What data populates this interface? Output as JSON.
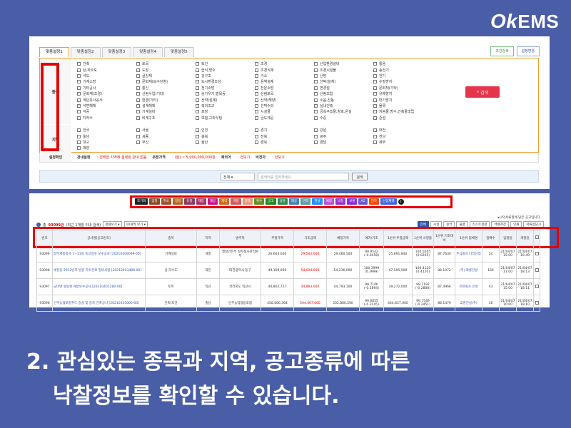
{
  "brand": {
    "logo_ok": "Ok",
    "logo_ems": "EMS"
  },
  "panel1": {
    "tabs": [
      "맞춤설정1",
      "맞춤설정2",
      "맞춤설정3",
      "맞춤설정4",
      "맞춤설정5"
    ],
    "right_buttons": [
      "조건검색",
      "설정변경"
    ],
    "category_label": "종목",
    "category_items": [
      "건축",
      "토목",
      "토건",
      "조경",
      "산업환경설비",
      "통용",
      "상,하수도",
      "도장",
      "습식,방수",
      "조경식재",
      "조경시설물",
      "송전기",
      "석도",
      "골강재",
      "강구조",
      "가스",
      "난방",
      "전기",
      "기계소방",
      "문화재(보수단청)",
      "도시환경조성",
      "용역설계",
      "선박(설계)",
      "수질방지",
      "기타공사",
      "통신",
      "전기소방",
      "전문소방",
      "변경설",
      "문화재(기타)",
      "문화재(조경)",
      "산림사업(기타)",
      "승가우기,벌목등",
      "산림토목",
      "산림조합",
      "유해방지",
      "계단유사공사",
      "환경(기타)",
      "산약(설계)",
      "산약(해양)",
      "소음,진동",
      "대기방지",
      "석면해체",
      "설계해체",
      "축의조고",
      "선박수리",
      "실내건축",
      "물류",
      "석공",
      "기계설비",
      "포장",
      "시설물",
      "금속구조물,창호,온실",
      "지붕물 방수,건축물조립",
      "지하수",
      "비계구조",
      "보험,그라우팅",
      "금도체공",
      "수중",
      "준설"
    ],
    "region_label": "지역",
    "region_items": [
      "전국",
      "서울",
      "인천",
      "경기",
      "강원",
      "대전",
      "충남",
      "세종",
      "충북",
      "전북",
      "광주",
      "전남",
      "대구",
      "부산",
      "울산",
      "경북",
      "경남",
      "제주",
      "제양"
    ],
    "search_button": "검색",
    "settings": {
      "label": "설정확인",
      "filter_title": "관내설정",
      "filter_value": ": 선택한 지역에 설정된 관내 없음",
      "price_title": "추정가격",
      "price_value": ": (원) ~ 5,000,000,000원",
      "exclude_title": "제외어",
      "exclude_value": ": 전보기",
      "exclude2_title": "비전자",
      "exclude2_value": ": 전보기"
    },
    "search_bar": {
      "select": "전체",
      "placeholder": "검색어를 입력하세요.",
      "button": "검색"
    }
  },
  "panel2": {
    "chips": [
      {
        "label": "조기화",
        "color": "#222222"
      },
      {
        "label": "입찰",
        "color": "#8a4b2a"
      },
      {
        "label": "취소",
        "color": "#a0522d"
      },
      {
        "label": "정정",
        "color": "#b5651d"
      },
      {
        "label": "유찰",
        "color": "#8b3a62"
      },
      {
        "label": "재입",
        "color": "#b03060"
      },
      {
        "label": "재공",
        "color": "#c71585"
      },
      {
        "label": "계약",
        "color": "#d2691e"
      },
      {
        "label": "개찰",
        "color": "#cd5c5c"
      },
      {
        "label": "결과",
        "color": "#e9967a"
      },
      {
        "label": "복수",
        "color": "#6b8e23"
      },
      {
        "label": "공고",
        "color": "#228b22"
      },
      {
        "label": "설명",
        "color": "#2e8b57"
      },
      {
        "label": "재공",
        "color": "#4682b4"
      },
      {
        "label": "견적",
        "color": "#5f9ea0"
      },
      {
        "label": "현설",
        "color": "#1e90ff"
      },
      {
        "label": "예정",
        "color": "#ba55d3"
      },
      {
        "label": "낙찰",
        "color": "#9932cc"
      },
      {
        "label": "보류",
        "color": "#8a2be2"
      },
      {
        "label": "AZ",
        "color": "#6a5acd"
      },
      {
        "label": "전자",
        "color": "#ff4500"
      },
      {
        "label": "산업재해",
        "color": "#4169e1"
      }
    ],
    "notice": "▸나의서류함에 담은 공고입니다.",
    "count_prefix": "총",
    "count": "93099건",
    "count_suffix": "(최근 1개월 이내 검색)",
    "sort_select": "정렬보기",
    "page_select": "10개씩 보기",
    "tools": [
      "전체",
      "시설",
      "용역",
      "물품",
      "리스트설정",
      "엑셀저장",
      "인쇄",
      "서류함담기"
    ],
    "table": {
      "headers": [
        "번호",
        "공사명[공고번호]",
        "종목",
        "지역",
        "발주처",
        "추정가격",
        "기초금액",
        "예정가격",
        "예가/기초",
        "1순위 투찰금액",
        "1순위 사정율",
        "1순위 기초대비",
        "1순위 업체명",
        "참여수",
        "입찰일",
        "개찰일",
        ""
      ],
      "rows": [
        [
          "93099",
          "정부세종청사 1~11동 옥상방수 보수공사 [20210409099-00]",
          "기계설비",
          "세종",
          "행정안전부 정부청사관리본부",
          "26,603,000",
          "29,502,000",
          "29,480,500",
          "99.9542 (-0.0458)",
          "25,891,840",
          "100.0205 (0.0205)",
          "87.7630",
          "주식회사 나라산업",
          "24",
          "21/04/07 15:00",
          "21/04/07 16:49"
        ],
        [
          "93098",
          "세천동 2012번지 일원 하수관로 정비사업 [20210403488-00]",
          "상,하수도",
          "대전",
          "대전광역시 동구",
          "49,109,090",
          "54,020,000",
          "54,236,000",
          "100.3999 (0.3999)",
          "47,595,500",
          "100.4120 (0.4120)",
          "88.1072",
          "(주) 와룡건설",
          "166",
          "21/04/07 11:00",
          "21/04/07 18:13"
        ],
        [
          "93097",
          "금마면 왕봉천 재방보수공사 [20210401280-00]",
          "토목",
          "익산",
          "전라북도 익산시",
          "40,802,727",
          "44,883,000",
          "44,793,100",
          "99.7106 (-0.2894)",
          "39,272,000",
          "99.7192 (-0.2808)",
          "87.4966",
          "유한회사 은성",
          "43",
          "21/04/07 15:00",
          "21/04/07 18:11"
        ],
        [
          "93096",
          "인주농협로컬푸드 증설 및 증축 건축공사 [20210335000-00]",
          "건축/토건",
          "충남",
          "인주농업협동조합",
          "458,606,364",
          "504,467,000",
          "502,880,500",
          "99.6855 (-0.3145)",
          "444,657,000",
          "99.7549 (-0.2451)",
          "88.1479",
          "교원건설(주)",
          "16",
          "21/04/07 10:00",
          "21/04/07 18:10"
        ]
      ]
    }
  },
  "caption": {
    "line1": "2. 관심있는 종목과 지역, 공고종류에 따른",
    "line2": "낙찰정보를 확인할 수 있습니다."
  }
}
